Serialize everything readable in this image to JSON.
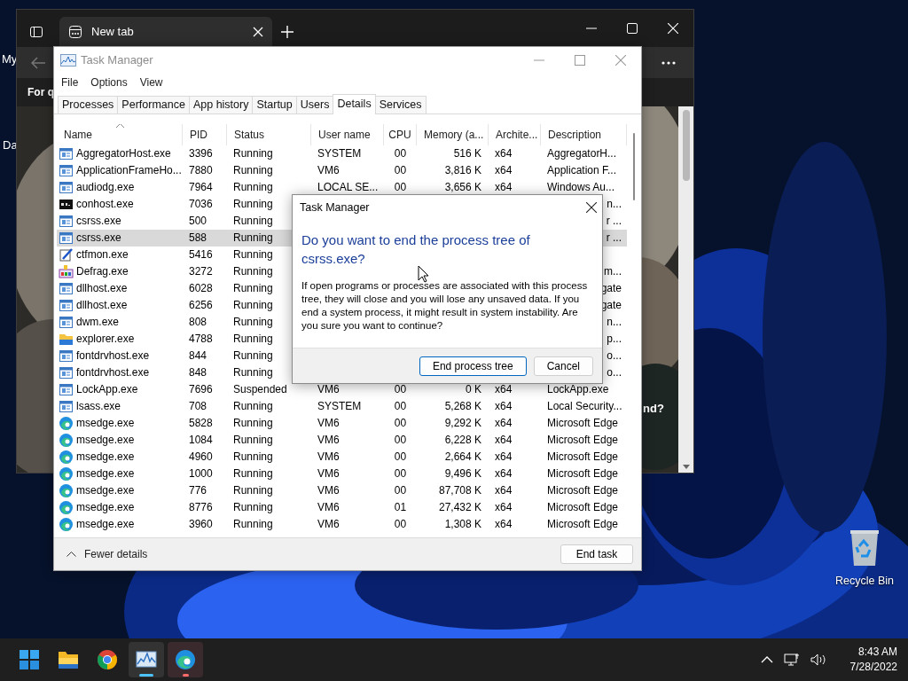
{
  "desktop": {
    "fragments": [
      "My",
      "Da"
    ],
    "recycle_bin": {
      "label": "Recycle Bin"
    }
  },
  "browser": {
    "tabs": [
      {
        "label": "New tab",
        "selected": true
      }
    ],
    "band_text": "For q",
    "content_text": "nd?"
  },
  "task_manager": {
    "title": "Task Manager",
    "menu": [
      "File",
      "Options",
      "View"
    ],
    "tabs": [
      {
        "label": "Processes",
        "selected": false
      },
      {
        "label": "Performance",
        "selected": false
      },
      {
        "label": "App history",
        "selected": false
      },
      {
        "label": "Startup",
        "selected": false
      },
      {
        "label": "Users",
        "selected": false
      },
      {
        "label": "Details",
        "selected": true
      },
      {
        "label": "Services",
        "selected": false
      }
    ],
    "columns": [
      {
        "label": "Name",
        "sorted": true
      },
      {
        "label": "PID",
        "sorted": false
      },
      {
        "label": "Status",
        "sorted": false
      },
      {
        "label": "User name",
        "sorted": false
      },
      {
        "label": "CPU",
        "sorted": false
      },
      {
        "label": "Memory (a...",
        "sorted": false
      },
      {
        "label": "Archite...",
        "sorted": false
      },
      {
        "label": "Description",
        "sorted": false
      }
    ],
    "rows": [
      {
        "kind": "app",
        "name": "AggregatorHost.exe",
        "pid": "3396",
        "status": "Running",
        "user": "SYSTEM",
        "cpu": "00",
        "memory": "516 K",
        "arch": "x64",
        "description": "AggregatorH...",
        "selected": false
      },
      {
        "kind": "app",
        "name": "ApplicationFrameHo...",
        "pid": "7880",
        "status": "Running",
        "user": "VM6",
        "cpu": "00",
        "memory": "3,816 K",
        "arch": "x64",
        "description": "Application F...",
        "selected": false
      },
      {
        "kind": "app",
        "name": "audiodg.exe",
        "pid": "7964",
        "status": "Running",
        "user": "LOCAL SE...",
        "cpu": "00",
        "memory": "3,656 K",
        "arch": "x64",
        "description": "Windows Au...",
        "selected": false
      },
      {
        "kind": "console",
        "name": "conhost.exe",
        "pid": "7036",
        "status": "Running",
        "description": "n...",
        "selected": false
      },
      {
        "kind": "app",
        "name": "csrss.exe",
        "pid": "500",
        "status": "Running",
        "description": "r ...",
        "selected": false
      },
      {
        "kind": "app",
        "name": "csrss.exe",
        "pid": "588",
        "status": "Running",
        "description": "r ...",
        "selected": true
      },
      {
        "kind": "pen",
        "name": "ctfmon.exe",
        "pid": "5416",
        "status": "Running",
        "selected": false
      },
      {
        "kind": "defrag",
        "name": "Defrag.exe",
        "pid": "3272",
        "status": "Running",
        "description": "m...",
        "selected": false
      },
      {
        "kind": "app",
        "name": "dllhost.exe",
        "pid": "6028",
        "status": "Running",
        "description": "gate",
        "selected": false
      },
      {
        "kind": "app",
        "name": "dllhost.exe",
        "pid": "6256",
        "status": "Running",
        "description": "gate",
        "selected": false
      },
      {
        "kind": "app",
        "name": "dwm.exe",
        "pid": "808",
        "status": "Running",
        "description": "n...",
        "selected": false
      },
      {
        "kind": "folder",
        "name": "explorer.exe",
        "pid": "4788",
        "status": "Running",
        "description": "p...",
        "selected": false
      },
      {
        "kind": "app",
        "name": "fontdrvhost.exe",
        "pid": "844",
        "status": "Running",
        "description": "o...",
        "selected": false
      },
      {
        "kind": "app",
        "name": "fontdrvhost.exe",
        "pid": "848",
        "status": "Running",
        "description": "o...",
        "selected": false
      },
      {
        "kind": "app",
        "name": "LockApp.exe",
        "pid": "7696",
        "status": "Suspended",
        "user": "VM6",
        "cpu": "00",
        "memory": "0 K",
        "arch": "x64",
        "description": "LockApp.exe",
        "selected": false
      },
      {
        "kind": "app",
        "name": "lsass.exe",
        "pid": "708",
        "status": "Running",
        "user": "SYSTEM",
        "cpu": "00",
        "memory": "5,268 K",
        "arch": "x64",
        "description": "Local Security...",
        "selected": false
      },
      {
        "kind": "edge",
        "name": "msedge.exe",
        "pid": "5828",
        "status": "Running",
        "user": "VM6",
        "cpu": "00",
        "memory": "9,292 K",
        "arch": "x64",
        "description": "Microsoft Edge",
        "selected": false
      },
      {
        "kind": "edge",
        "name": "msedge.exe",
        "pid": "1084",
        "status": "Running",
        "user": "VM6",
        "cpu": "00",
        "memory": "6,228 K",
        "arch": "x64",
        "description": "Microsoft Edge",
        "selected": false
      },
      {
        "kind": "edge",
        "name": "msedge.exe",
        "pid": "4960",
        "status": "Running",
        "user": "VM6",
        "cpu": "00",
        "memory": "2,664 K",
        "arch": "x64",
        "description": "Microsoft Edge",
        "selected": false
      },
      {
        "kind": "edge",
        "name": "msedge.exe",
        "pid": "1000",
        "status": "Running",
        "user": "VM6",
        "cpu": "00",
        "memory": "9,496 K",
        "arch": "x64",
        "description": "Microsoft Edge",
        "selected": false
      },
      {
        "kind": "edge",
        "name": "msedge.exe",
        "pid": "776",
        "status": "Running",
        "user": "VM6",
        "cpu": "00",
        "memory": "87,708 K",
        "arch": "x64",
        "description": "Microsoft Edge",
        "selected": false
      },
      {
        "kind": "edge",
        "name": "msedge.exe",
        "pid": "8776",
        "status": "Running",
        "user": "VM6",
        "cpu": "01",
        "memory": "27,432 K",
        "arch": "x64",
        "description": "Microsoft Edge",
        "selected": false
      },
      {
        "kind": "edge",
        "name": "msedge.exe",
        "pid": "3960",
        "status": "Running",
        "user": "VM6",
        "cpu": "00",
        "memory": "1,308 K",
        "arch": "x64",
        "description": "Microsoft Edge",
        "selected": false
      }
    ],
    "footer": {
      "toggle": "Fewer details",
      "end_task": "End task"
    }
  },
  "dialog": {
    "title": "Task Manager",
    "heading": "Do you want to end the process tree of csrss.exe?",
    "body": "If open programs or processes are associated with this process tree, they will close and you will lose any unsaved data. If you end a system process, it might result in system instability. Are you sure you want to continue?",
    "buttons": [
      {
        "label": "End process tree",
        "default": true
      },
      {
        "label": "Cancel",
        "default": false
      }
    ]
  },
  "taskbar": {
    "apps": [
      {
        "kind": "start",
        "running": false,
        "flashing": false
      },
      {
        "kind": "folder",
        "running": false,
        "flashing": false
      },
      {
        "kind": "browser",
        "running": false,
        "flashing": false
      },
      {
        "kind": "monitor",
        "running": true,
        "flashing": false
      },
      {
        "kind": "edge",
        "running": true,
        "flashing": true
      }
    ],
    "clock": {
      "time": "8:43 AM",
      "date": "7/28/2022"
    }
  }
}
